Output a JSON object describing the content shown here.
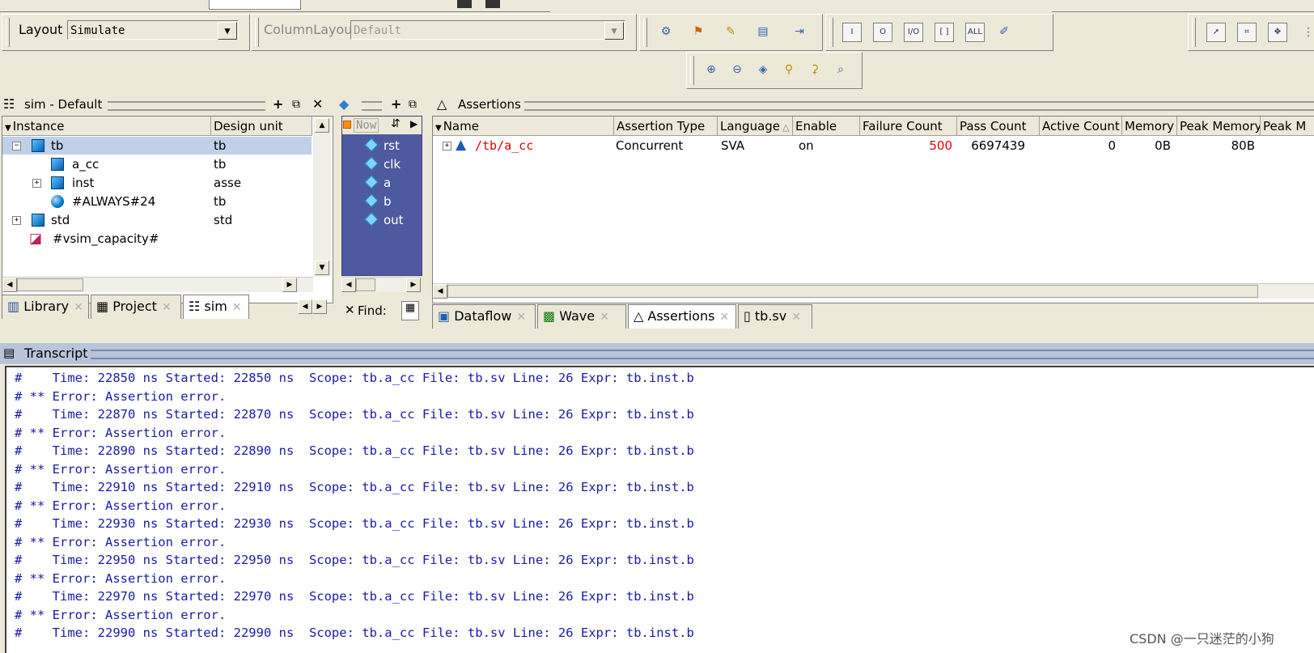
{
  "toolbar": {
    "layout_label": "Layout",
    "layout_value": "Simulate",
    "column_layout_label": "ColumnLayout",
    "column_layout_value": "Default",
    "view_buttons": [
      "I",
      "O",
      "I/O",
      "[ ]",
      "ALL"
    ]
  },
  "sim_pane": {
    "title": "sim - Default",
    "headers": {
      "instance": "Instance",
      "design_unit": "Design unit"
    },
    "rows": [
      {
        "name": "tb",
        "unit": "tb"
      },
      {
        "name": "a_cc",
        "unit": "tb"
      },
      {
        "name": "inst",
        "unit": "asse"
      },
      {
        "name": "#ALWAYS#24",
        "unit": "tb"
      },
      {
        "name": "std",
        "unit": "std"
      },
      {
        "name": "#vsim_capacity#",
        "unit": ""
      }
    ],
    "tabs": [
      "Library",
      "Project",
      "sim"
    ]
  },
  "objects_pane": {
    "now_label": "Now",
    "signals": [
      "rst",
      "clk",
      "a",
      "b",
      "out"
    ],
    "find_label": "Find:"
  },
  "assertions_pane": {
    "title": "Assertions",
    "headers": [
      "Name",
      "Assertion Type",
      "Language",
      "Enable",
      "Failure Count",
      "Pass Count",
      "Active Count",
      "Memory",
      "Peak Memory",
      "Peak M"
    ],
    "row": {
      "name": "/tb/a_cc",
      "type": "Concurrent",
      "language": "SVA",
      "enable": "on",
      "failure_count": "500",
      "pass_count": "6697439",
      "active_count": "0",
      "memory": "0B",
      "peak_memory": "80B"
    },
    "tabs": [
      "Dataflow",
      "Wave",
      "Assertions",
      "tb.sv"
    ]
  },
  "transcript": {
    "title": "Transcript",
    "lines": [
      "#    Time: 22850 ns Started: 22850 ns  Scope: tb.a_cc File: tb.sv Line: 26 Expr: tb.inst.b",
      "# ** Error: Assertion error.",
      "#    Time: 22870 ns Started: 22870 ns  Scope: tb.a_cc File: tb.sv Line: 26 Expr: tb.inst.b",
      "# ** Error: Assertion error.",
      "#    Time: 22890 ns Started: 22890 ns  Scope: tb.a_cc File: tb.sv Line: 26 Expr: tb.inst.b",
      "# ** Error: Assertion error.",
      "#    Time: 22910 ns Started: 22910 ns  Scope: tb.a_cc File: tb.sv Line: 26 Expr: tb.inst.b",
      "# ** Error: Assertion error.",
      "#    Time: 22930 ns Started: 22930 ns  Scope: tb.a_cc File: tb.sv Line: 26 Expr: tb.inst.b",
      "# ** Error: Assertion error.",
      "#    Time: 22950 ns Started: 22950 ns  Scope: tb.a_cc File: tb.sv Line: 26 Expr: tb.inst.b",
      "# ** Error: Assertion error.",
      "#    Time: 22970 ns Started: 22970 ns  Scope: tb.a_cc File: tb.sv Line: 26 Expr: tb.inst.b",
      "# ** Error: Assertion error.",
      "#    Time: 22990 ns Started: 22990 ns  Scope: tb.a_cc File: tb.sv Line: 26 Expr: tb.inst.b"
    ]
  },
  "watermark": "CSDN @一只迷茫的小狗",
  "colors": {
    "error_red": "#e00000",
    "transcript_blue": "#1a1aa6",
    "objects_bg": "#4e5aa0",
    "selection": "#c0d0e8"
  }
}
